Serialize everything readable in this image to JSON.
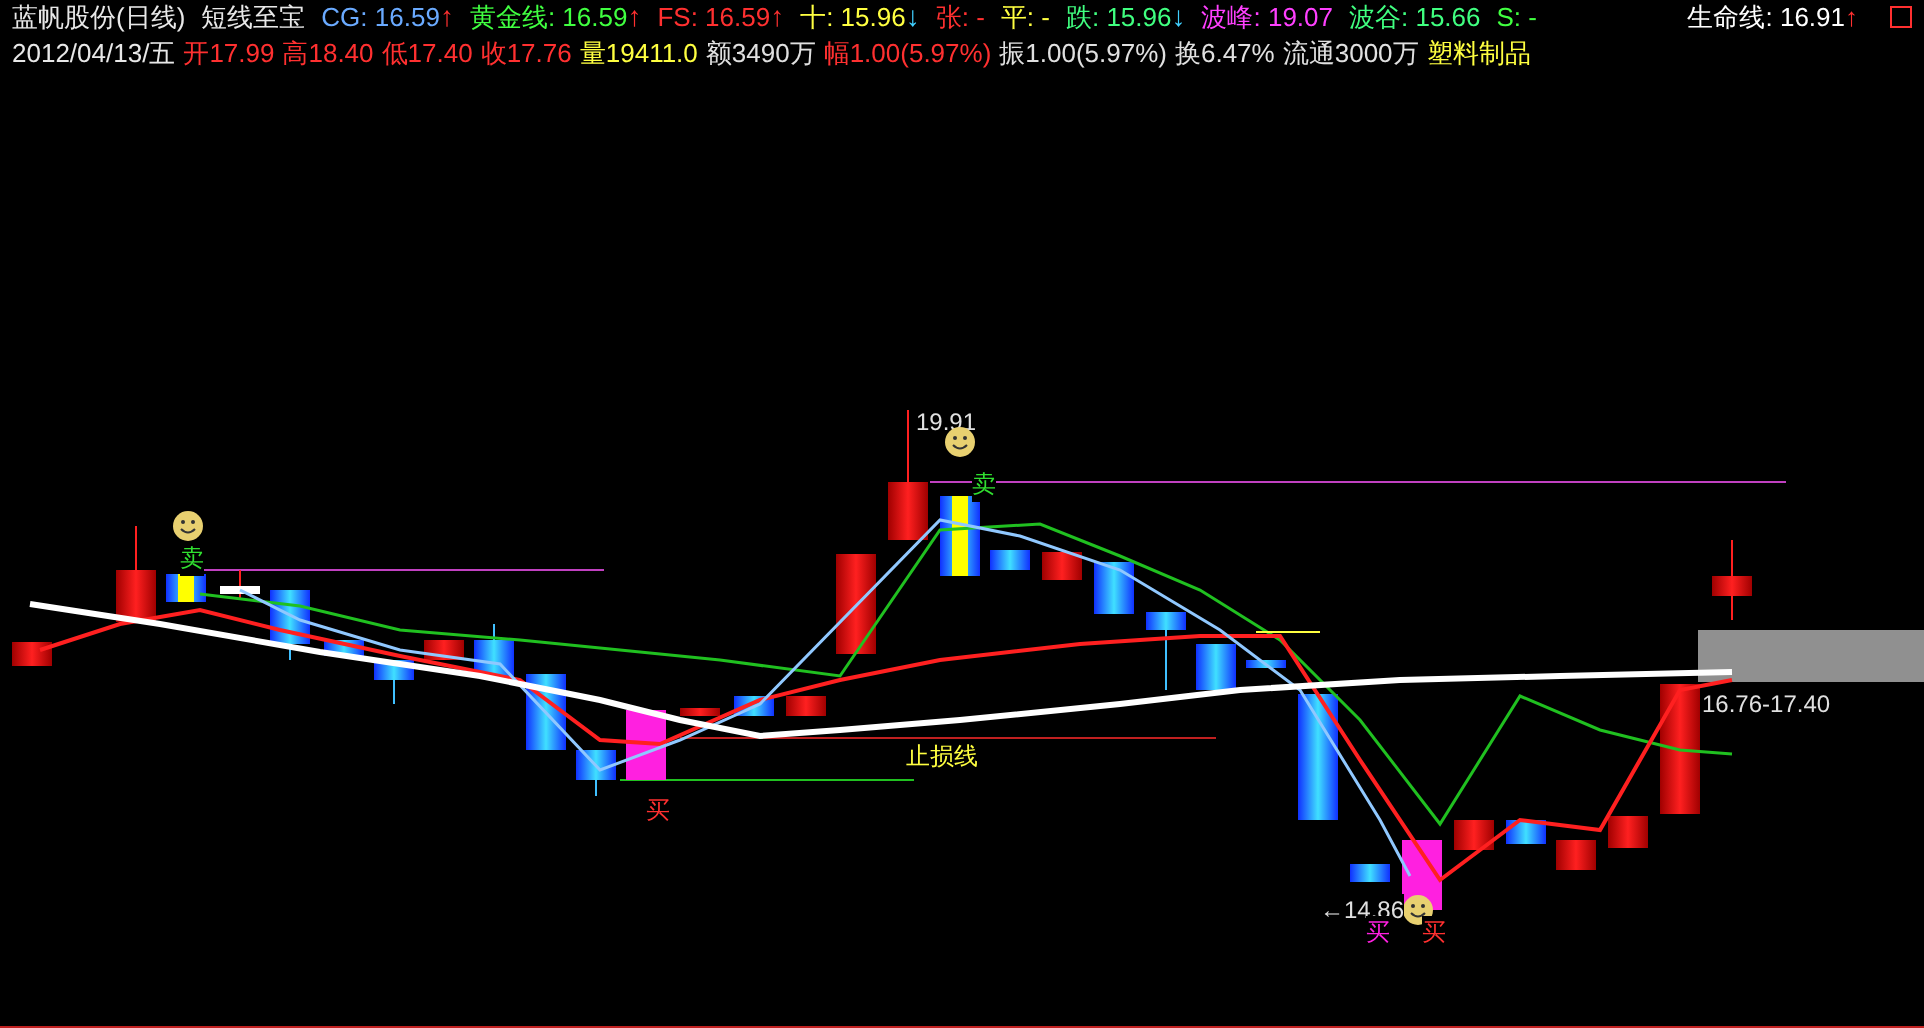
{
  "header": {
    "title": "蓝帆股份(日线)",
    "indicator": "短线至宝",
    "values": [
      {
        "label": "CG:",
        "value": "16.59",
        "arrow": {
          "text": "↑",
          "color": "#ff3030"
        },
        "color": "#6aaaff"
      },
      {
        "label": "黄金线:",
        "value": "16.59",
        "arrow": {
          "text": "↑",
          "color": "#ff3030"
        },
        "color": "#40ff40"
      },
      {
        "label": "FS:",
        "value": "16.59",
        "arrow": {
          "text": "↑",
          "color": "#ff3030"
        },
        "color": "#ff3030"
      },
      {
        "label": "十:",
        "value": "15.96",
        "arrow": {
          "text": "↓",
          "color": "#40d0ff"
        },
        "color": "#ffff40"
      },
      {
        "label": "张:",
        "value": "-",
        "color": "#ff3030"
      },
      {
        "label": "平:",
        "value": "-",
        "color": "#ffff40"
      },
      {
        "label": "跌:",
        "value": "15.96",
        "arrow": {
          "text": "↓",
          "color": "#40d0ff"
        },
        "color": "#40ff80"
      },
      {
        "label": "波峰:",
        "value": "19.07",
        "color": "#ff40ff"
      },
      {
        "label": "波谷:",
        "value": "15.66",
        "color": "#40ff80"
      },
      {
        "label": "S:",
        "value": "-",
        "color": "#40ff40"
      }
    ],
    "life_line": {
      "label": "生命线:",
      "value": "16.91",
      "arrow": "↑"
    }
  },
  "quote_line": {
    "date": "2012/04/13/五",
    "items": [
      {
        "text": "开17.99",
        "color": "#ff3030"
      },
      {
        "text": "高18.40",
        "color": "#ff3030"
      },
      {
        "text": "低17.40",
        "color": "#ff3030"
      },
      {
        "text": "收17.76",
        "color": "#ff3030"
      },
      {
        "text": "量19411.0",
        "color": "#ffff40"
      },
      {
        "text": "额3490万",
        "color": "#e0e0e0"
      },
      {
        "text": "幅1.00(5.97%)",
        "color": "#ff3030"
      },
      {
        "text": "振1.00(5.97%)",
        "color": "#e0e0e0"
      },
      {
        "text": "换6.47%",
        "color": "#e0e0e0"
      },
      {
        "text": "流通3000万",
        "color": "#e0e0e0"
      },
      {
        "text": "塑料制品",
        "color": "#ffff40"
      }
    ]
  },
  "chart": {
    "high_label": "19.91",
    "low_label": "←14.86",
    "range_label": "16.76-17.40",
    "stop_loss_label": "止损线",
    "signals": [
      {
        "kind": "sell",
        "text": "卖"
      },
      {
        "kind": "sell",
        "text": "卖"
      },
      {
        "kind": "buy",
        "text": "买"
      },
      {
        "kind": "buy",
        "text": "买"
      },
      {
        "kind": "buy",
        "text": "买"
      }
    ]
  }
}
